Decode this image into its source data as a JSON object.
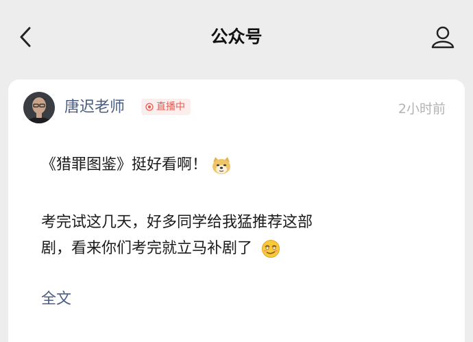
{
  "header": {
    "title": "公众号",
    "back_icon": "chevron-left-icon",
    "profile_icon": "person-icon"
  },
  "post": {
    "author": "唐迟老师",
    "live_badge": "直播中",
    "timestamp": "2小时前",
    "paragraph1": "《猎罪图鉴》挺好看啊！",
    "paragraph1_emoji": "doge-emoji-icon",
    "paragraph2_line1": "考完试这几天，好多同学给我猛推荐这部",
    "paragraph2_line2": "剧，看来你们考完就立马补剧了",
    "paragraph2_emoji": "smirk-emoji-icon",
    "full_text_link": "全文"
  },
  "colors": {
    "background": "#ededed",
    "card": "#ffffff",
    "link_blue": "#4a5d82",
    "live_red": "#e8594f",
    "muted": "#b2b2b2"
  }
}
